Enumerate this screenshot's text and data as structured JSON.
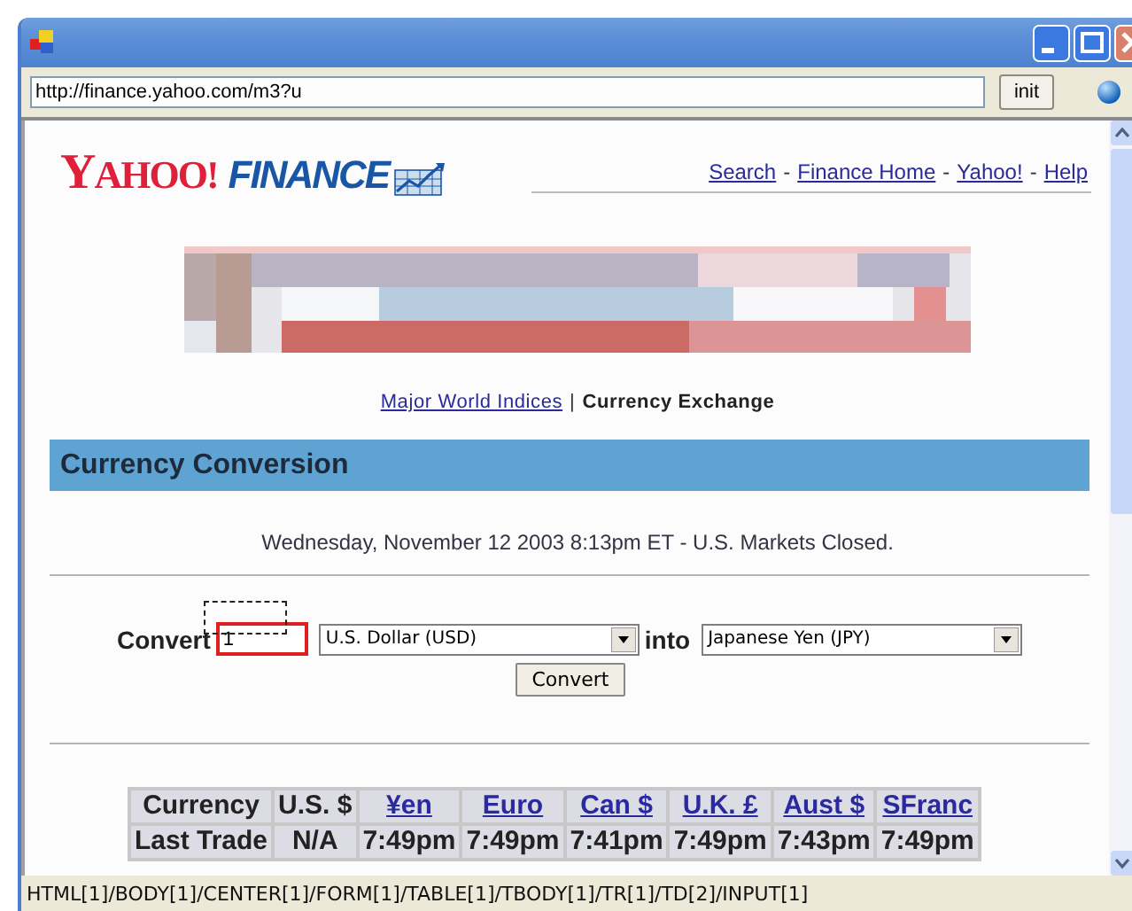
{
  "address_bar": {
    "value": "http://finance.yahoo.com/m3?u",
    "button": "init"
  },
  "logo": {
    "brand": "YAHOO!",
    "product": "FINANCE"
  },
  "header_links": [
    {
      "label": "Search"
    },
    {
      "label": "Finance Home"
    },
    {
      "label": "Yahoo!"
    },
    {
      "label": "Help"
    }
  ],
  "header_link_separator": "-",
  "nav": {
    "separator": "|",
    "items": [
      {
        "label": "Major World Indices",
        "selected": false
      },
      {
        "label": "Currency Exchange",
        "selected": true
      }
    ]
  },
  "section_title": "Currency Conversion",
  "date_line": "Wednesday, November 12 2003 8:13pm ET - U.S. Markets Closed.",
  "form": {
    "label": "Convert",
    "amount": "1",
    "amount_focused": true,
    "from": "U.S. Dollar (USD)",
    "into_label": "into",
    "to": "Japanese Yen (JPY)",
    "button": "Convert"
  },
  "table": {
    "columns": [
      {
        "label": "Currency",
        "link": false
      },
      {
        "label": "U.S. $",
        "link": false
      },
      {
        "label": "¥en",
        "link": true
      },
      {
        "label": "Euro",
        "link": true
      },
      {
        "label": "Can $",
        "link": true
      },
      {
        "label": "U.K. £",
        "link": true
      },
      {
        "label": "Aust $",
        "link": true
      },
      {
        "label": "SFranc",
        "link": true
      }
    ],
    "rows": [
      [
        "Last Trade",
        "N/A",
        "7:49pm",
        "7:49pm",
        "7:41pm",
        "7:49pm",
        "7:43pm",
        "7:49pm"
      ]
    ]
  },
  "status_bar": "HTML[1]/BODY[1]/CENTER[1]/FORM[1]/TABLE[1]/TBODY[1]/TR[1]/TD[2]/INPUT[1]"
}
